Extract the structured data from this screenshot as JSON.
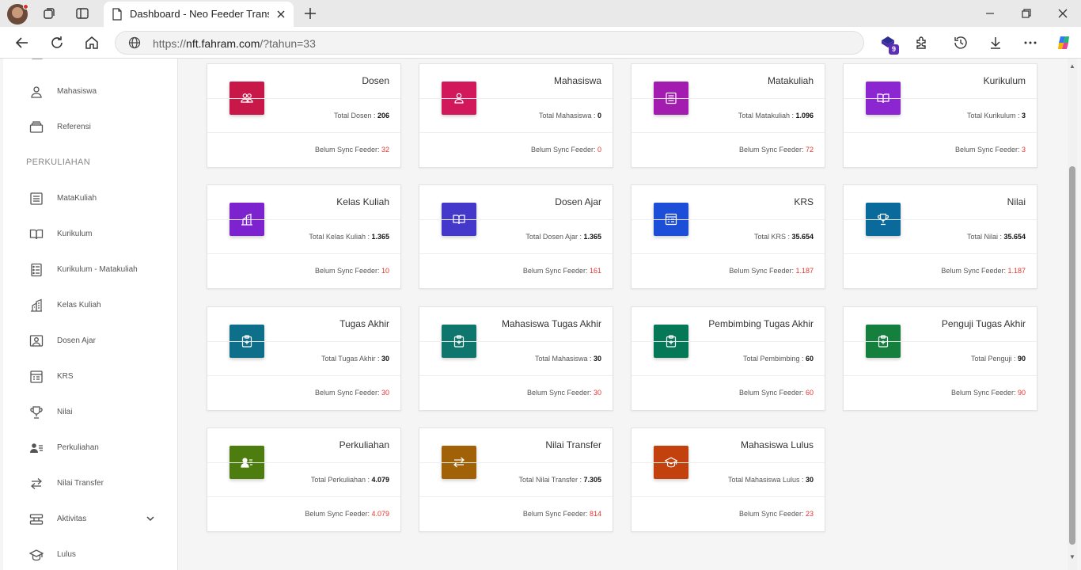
{
  "browser": {
    "tab_title": "Dashboard - Neo Feeder Transpor",
    "url_scheme": "https://",
    "url_host": "nft.fahram.com",
    "url_path": "/?tahun=33",
    "extension_badge": "9"
  },
  "sidebar": {
    "items_top": [
      {
        "label": "Mahasiswa",
        "icon": "user-icon"
      },
      {
        "label": "Referensi",
        "icon": "inbox-icon"
      }
    ],
    "section_title": "PERKULIAHAN",
    "items": [
      {
        "label": "MataKuliah",
        "icon": "list-icon"
      },
      {
        "label": "Kurikulum",
        "icon": "book-open-icon"
      },
      {
        "label": "Kurikulum - Matakuliah",
        "icon": "file-list-icon"
      },
      {
        "label": "Kelas Kuliah",
        "icon": "building-icon"
      },
      {
        "label": "Dosen Ajar",
        "icon": "teacher-icon"
      },
      {
        "label": "KRS",
        "icon": "table-icon"
      },
      {
        "label": "Nilai",
        "icon": "trophy-icon"
      },
      {
        "label": "Perkuliahan",
        "icon": "user-list-icon"
      },
      {
        "label": "Nilai Transfer",
        "icon": "transfer-icon"
      },
      {
        "label": "Aktivitas",
        "icon": "sliders-icon"
      },
      {
        "label": "Lulus",
        "icon": "graduation-cap-icon"
      }
    ]
  },
  "cards": [
    {
      "title": "Dosen",
      "total_label": "Total Dosen : ",
      "total": "206",
      "sync_label": "Belum Sync Feeder: ",
      "sync": "32",
      "color": "#c8184a",
      "icon": "users-icon"
    },
    {
      "title": "Mahasiswa",
      "total_label": "Total Mahasiswa : ",
      "total": "0",
      "sync_label": "Belum Sync Feeder: ",
      "sync": "0",
      "color": "#d1185b",
      "icon": "user-icon"
    },
    {
      "title": "Matakuliah",
      "total_label": "Total Matakuliah : ",
      "total": "1.096",
      "sync_label": "Belum Sync Feeder: ",
      "sync": "72",
      "color": "#a21caf",
      "icon": "list-icon"
    },
    {
      "title": "Kurikulum",
      "total_label": "Total Kurikulum : ",
      "total": "3",
      "sync_label": "Belum Sync Feeder: ",
      "sync": "3",
      "color": "#8b26d0",
      "icon": "book-open-icon"
    },
    {
      "title": "Kelas Kuliah",
      "total_label": "Total Kelas Kuliah : ",
      "total": "1.365",
      "sync_label": "Belum Sync Feeder: ",
      "sync": "10",
      "color": "#7c22ce",
      "icon": "building-icon"
    },
    {
      "title": "Dosen Ajar",
      "total_label": "Total Dosen Ajar : ",
      "total": "1.365",
      "sync_label": "Belum Sync Feeder: ",
      "sync": "161",
      "color": "#4338ca",
      "icon": "book-open-icon"
    },
    {
      "title": "KRS",
      "total_label": "Total KRS : ",
      "total": "35.654",
      "sync_label": "Belum Sync Feeder: ",
      "sync": "1.187",
      "color": "#1d4ed8",
      "icon": "table-icon"
    },
    {
      "title": "Nilai",
      "total_label": "Total Nilai : ",
      "total": "35.654",
      "sync_label": "Belum Sync Feeder: ",
      "sync": "1.187",
      "color": "#0b6a9c",
      "icon": "trophy-icon"
    },
    {
      "title": "Tugas Akhir",
      "total_label": "Total Tugas Akhir : ",
      "total": "30",
      "sync_label": "Belum Sync Feeder: ",
      "sync": "30",
      "color": "#0e6f8a",
      "icon": "clipboard-plus-icon"
    },
    {
      "title": "Mahasiswa Tugas Akhir",
      "total_label": "Total Mahasiswa : ",
      "total": "30",
      "sync_label": "Belum Sync Feeder: ",
      "sync": "30",
      "color": "#0f766e",
      "icon": "clipboard-plus-icon"
    },
    {
      "title": "Pembimbing Tugas Akhir",
      "total_label": "Total Pembimbing : ",
      "total": "60",
      "sync_label": "Belum Sync Feeder: ",
      "sync": "60",
      "color": "#047857",
      "icon": "clipboard-plus-icon"
    },
    {
      "title": "Penguji Tugas Akhir",
      "total_label": "Total Penguji : ",
      "total": "90",
      "sync_label": "Belum Sync Feeder: ",
      "sync": "90",
      "color": "#15803d",
      "icon": "clipboard-plus-icon"
    },
    {
      "title": "Perkuliahan",
      "total_label": "Total Perkuliahan : ",
      "total": "4.079",
      "sync_label": "Belum Sync Feeder: ",
      "sync": "4.079",
      "color": "#4d7c0f",
      "icon": "user-list-icon"
    },
    {
      "title": "Nilai Transfer",
      "total_label": "Total Nilai Transfer : ",
      "total": "7.305",
      "sync_label": "Belum Sync Feeder: ",
      "sync": "814",
      "color": "#a16207",
      "icon": "transfer-icon"
    },
    {
      "title": "Mahasiswa Lulus",
      "total_label": "Total Mahasiswa Lulus : ",
      "total": "30",
      "sync_label": "Belum Sync Feeder: ",
      "sync": "23",
      "color": "#c2410c",
      "icon": "graduation-cap-icon"
    }
  ]
}
